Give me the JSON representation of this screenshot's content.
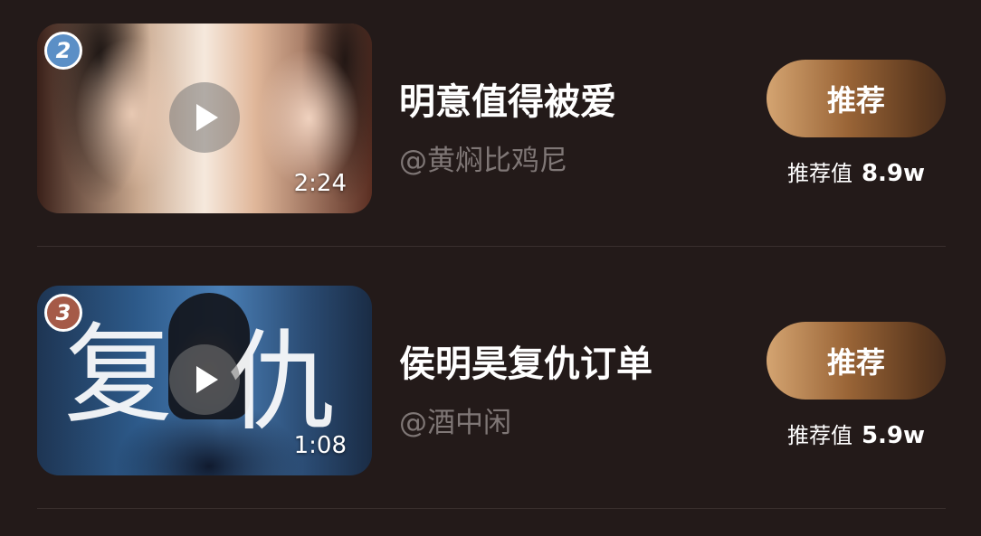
{
  "items": [
    {
      "rank": "2",
      "rank_color": "#5b8fc6",
      "duration": "2:24",
      "title": "明意值得被爱",
      "author": "@黄焖比鸡尼",
      "button_label": "推荐",
      "score_label": "推荐值",
      "score_value": "8.9w"
    },
    {
      "rank": "3",
      "rank_color": "#a55a48",
      "duration": "1:08",
      "title": "侯明昊复仇订单",
      "author": "@酒中闲",
      "button_label": "推荐",
      "score_label": "推荐值",
      "score_value": "5.9w",
      "thumbnail_text": [
        "复",
        "仇"
      ]
    }
  ],
  "colors": {
    "background": "#231a19",
    "title": "#ffffff",
    "author": "#7f7776",
    "button_gradient_start": "#d4a471",
    "button_gradient_end": "#4a2e1c",
    "divider": "#3a302e"
  },
  "icons": {
    "play": "play-icon"
  }
}
